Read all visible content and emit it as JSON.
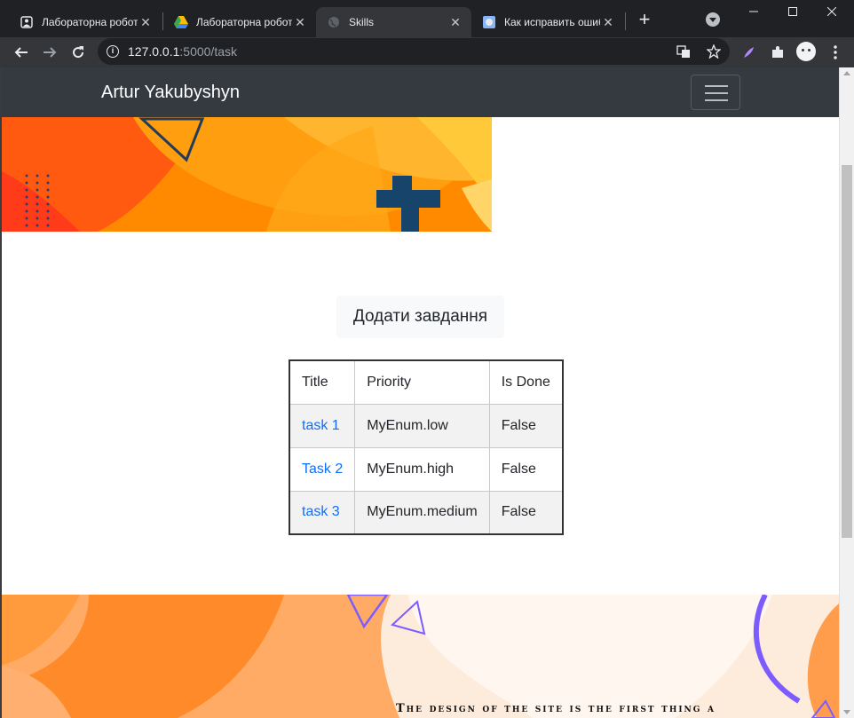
{
  "browser": {
    "tabs": [
      {
        "title": "Лабораторна робота",
        "icon": "contact-icon"
      },
      {
        "title": "Лабораторна робота",
        "icon": "drive-icon"
      },
      {
        "title": "Skills",
        "icon": "globe-icon",
        "active": true
      },
      {
        "title": "Как исправить ошибку",
        "icon": "page-icon"
      }
    ],
    "url_host": "127.0.0.1",
    "url_path": ":5000/task",
    "close_glyph": "✕",
    "new_tab_glyph": "+"
  },
  "site": {
    "brand": "Artur Yakubyshyn",
    "add_task_label": "Додати завдання",
    "table": {
      "headers": [
        "Title",
        "Priority",
        "Is Done"
      ],
      "rows": [
        {
          "title": "task 1",
          "priority": "MyEnum.low",
          "done": "False"
        },
        {
          "title": "Task 2",
          "priority": "MyEnum.high",
          "done": "False"
        },
        {
          "title": "task 3",
          "priority": "MyEnum.medium",
          "done": "False"
        }
      ]
    },
    "footer_tagline": "The design of the site is the first thing a"
  },
  "colors": {
    "navbar": "#343a40",
    "link": "#0d6efd",
    "accent_orange": "#ff6a1a"
  }
}
